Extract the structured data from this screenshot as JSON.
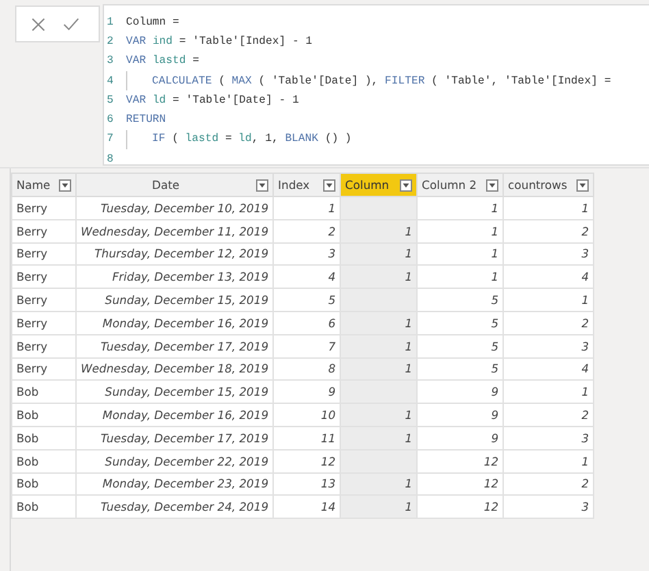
{
  "formula_bar": {
    "buttons": [
      {
        "kind": "cancel"
      },
      {
        "kind": "commit"
      }
    ],
    "lines": [
      {
        "number": "1",
        "indented": false,
        "tokens": [
          {
            "kind": "text",
            "text": "Column ="
          }
        ]
      },
      {
        "number": "2",
        "indented": false,
        "tokens": [
          {
            "kind": "keyword",
            "text": "VAR "
          },
          {
            "kind": "variable",
            "text": "ind"
          },
          {
            "kind": "text",
            "text": " = 'Table'[Index] - 1"
          }
        ]
      },
      {
        "number": "3",
        "indented": false,
        "tokens": [
          {
            "kind": "keyword",
            "text": "VAR "
          },
          {
            "kind": "variable",
            "text": "lastd"
          },
          {
            "kind": "text",
            "text": " ="
          }
        ]
      },
      {
        "number": "4",
        "indented": true,
        "tokens": [
          {
            "kind": "keyword",
            "text": "CALCULATE"
          },
          {
            "kind": "text",
            "text": " ( "
          },
          {
            "kind": "keyword",
            "text": "MAX"
          },
          {
            "kind": "text",
            "text": " ( 'Table'[Date] ), "
          },
          {
            "kind": "keyword",
            "text": "FILTER"
          },
          {
            "kind": "text",
            "text": " ( 'Table', 'Table'[Index] ="
          }
        ]
      },
      {
        "number": "5",
        "indented": false,
        "tokens": [
          {
            "kind": "keyword",
            "text": "VAR "
          },
          {
            "kind": "variable",
            "text": "ld"
          },
          {
            "kind": "text",
            "text": " = 'Table'[Date] - 1"
          }
        ]
      },
      {
        "number": "6",
        "indented": false,
        "tokens": [
          {
            "kind": "keyword",
            "text": "RETURN"
          }
        ]
      },
      {
        "number": "7",
        "indented": true,
        "tokens": [
          {
            "kind": "keyword",
            "text": "IF"
          },
          {
            "kind": "text",
            "text": " ( "
          },
          {
            "kind": "variable",
            "text": "lastd"
          },
          {
            "kind": "text",
            "text": " = "
          },
          {
            "kind": "variable",
            "text": "ld"
          },
          {
            "kind": "text",
            "text": ", 1, "
          },
          {
            "kind": "keyword",
            "text": "BLANK"
          },
          {
            "kind": "text",
            "text": " () )"
          }
        ]
      },
      {
        "number": "8",
        "indented": false
      }
    ]
  },
  "table": {
    "columns": [
      {
        "label": "Name",
        "kind": "text",
        "selected": false
      },
      {
        "label": "Date",
        "kind": "date",
        "selected": false
      },
      {
        "label": "Index",
        "kind": "number",
        "selected": false
      },
      {
        "label": "Column",
        "kind": "number",
        "selected": true
      },
      {
        "label": "Column 2",
        "kind": "number",
        "selected": false
      },
      {
        "label": "countrows",
        "kind": "number",
        "selected": false
      }
    ],
    "rows": [
      [
        "Berry",
        "Tuesday, December 10, 2019",
        "1",
        null,
        "1",
        "1"
      ],
      [
        "Berry",
        "Wednesday, December 11, 2019",
        "2",
        "1",
        "1",
        "2"
      ],
      [
        "Berry",
        "Thursday, December 12, 2019",
        "3",
        "1",
        "1",
        "3"
      ],
      [
        "Berry",
        "Friday, December 13, 2019",
        "4",
        "1",
        "1",
        "4"
      ],
      [
        "Berry",
        "Sunday, December 15, 2019",
        "5",
        null,
        "5",
        "1"
      ],
      [
        "Berry",
        "Monday, December 16, 2019",
        "6",
        "1",
        "5",
        "2"
      ],
      [
        "Berry",
        "Tuesday, December 17, 2019",
        "7",
        "1",
        "5",
        "3"
      ],
      [
        "Berry",
        "Wednesday, December 18, 2019",
        "8",
        "1",
        "5",
        "4"
      ],
      [
        "Bob",
        "Sunday, December 15, 2019",
        "9",
        null,
        "9",
        "1"
      ],
      [
        "Bob",
        "Monday, December 16, 2019",
        "10",
        "1",
        "9",
        "2"
      ],
      [
        "Bob",
        "Tuesday, December 17, 2019",
        "11",
        "1",
        "9",
        "3"
      ],
      [
        "Bob",
        "Sunday, December 22, 2019",
        "12",
        null,
        "12",
        "1"
      ],
      [
        "Bob",
        "Monday, December 23, 2019",
        "13",
        "1",
        "12",
        "2"
      ],
      [
        "Bob",
        "Tuesday, December 24, 2019",
        "14",
        "1",
        "12",
        "3"
      ]
    ]
  }
}
